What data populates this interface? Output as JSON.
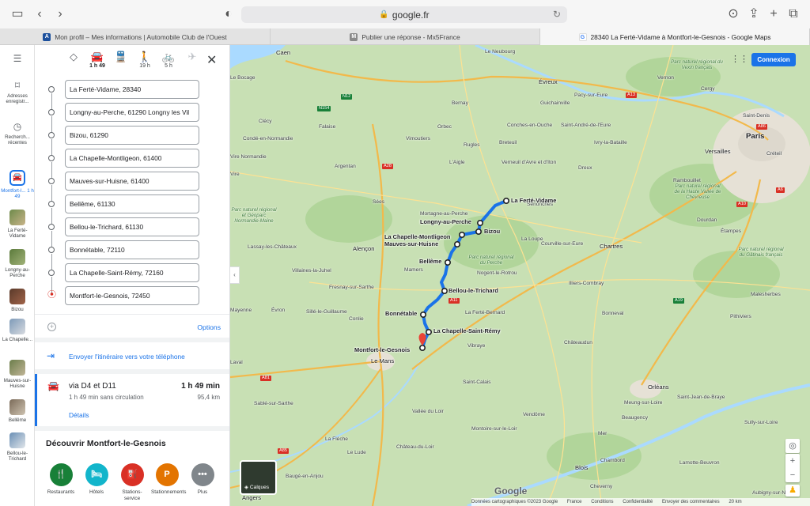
{
  "browser": {
    "url": "google.fr",
    "tabs": [
      {
        "title": "Mon profil – Mes informations | Automobile Club de l'Ouest",
        "favicon": "aco-icon"
      },
      {
        "title": "Publier une réponse - Mx5France",
        "favicon": "m-icon"
      },
      {
        "title": "28340 La Ferté-Vidame à Montfort-le-Gesnois - Google Maps",
        "favicon": "google-icon"
      }
    ]
  },
  "rail": {
    "items": [
      {
        "label": "Adresses enregistr...",
        "icon": "bookmark-icon"
      },
      {
        "label": "Recherch... récentes",
        "icon": "history-icon"
      },
      {
        "label": "Montfort-l... 1 h 49",
        "icon": "car-icon"
      },
      {
        "label": "La Ferté-Vidame"
      },
      {
        "label": "Longny-au-Perche"
      },
      {
        "label": "Bizou"
      },
      {
        "label": "La Chapelle..."
      },
      {
        "label": "Mauves-sur-Huisne"
      },
      {
        "label": "Bellême"
      },
      {
        "label": "Bellou-le-Trichard"
      }
    ]
  },
  "directions": {
    "modes": [
      {
        "name": "best-mode-icon",
        "label": ""
      },
      {
        "name": "car-icon",
        "label": "1 h 49"
      },
      {
        "name": "transit-icon",
        "label": ""
      },
      {
        "name": "walk-icon",
        "label": "19 h"
      },
      {
        "name": "bike-icon",
        "label": "5 h"
      },
      {
        "name": "flight-icon",
        "label": ""
      }
    ],
    "stops": [
      "La Ferté-Vidame, 28340",
      "Longny-au-Perche, 61290 Longny les Vil",
      "Bizou, 61290",
      "La Chapelle-Montligeon, 61400",
      "Mauves-sur-Huisne, 61400",
      "Bellême, 61130",
      "Bellou-le-Trichard, 61130",
      "Bonnétable, 72110",
      "La Chapelle-Saint-Rémy, 72160",
      "Montfort-le-Gesnois, 72450"
    ],
    "options_label": "Options",
    "send_label": "Envoyer l'itinéraire vers votre téléphone",
    "route": {
      "via": "via D4 et D11",
      "time": "1 h 49 min",
      "sub": "1 h 49 min sans circulation",
      "distance": "95,4 km",
      "details_label": "Détails"
    },
    "discover": {
      "title": "Découvrir Montfort-le-Gesnois",
      "items": [
        {
          "label": "Restaurants",
          "icon": "restaurant-icon",
          "color": "#188038"
        },
        {
          "label": "Hôtels",
          "icon": "hotel-icon",
          "color": "#12b5cb"
        },
        {
          "label": "Stations-service",
          "icon": "fuel-icon",
          "color": "#d93025"
        },
        {
          "label": "Stationnements",
          "icon": "parking-icon",
          "color": "#e37400"
        },
        {
          "label": "Plus",
          "icon": "more-icon",
          "color": "#80868b"
        }
      ]
    }
  },
  "map": {
    "connexion_label": "Connexion",
    "layers_label": "Calques",
    "route_color": "#1a73e8",
    "stop_labels": [
      "La Ferté-Vidame",
      "Longny-au-Perche",
      "Bizou",
      "La Chapelle-Montligeon",
      "Mauves-sur-Huisne",
      "Bellême",
      "Bellou-le-Trichard",
      "Bonnétable",
      "La Chapelle-Saint-Rémy",
      "Montfort-le-Gesnois"
    ],
    "places": [
      "Caen",
      "Le Neubourg",
      "Vernon",
      "Le Bocage",
      "Évreux",
      "Pacy-sur-Eure",
      "Guichainville",
      "Condé-en-Normandie",
      "Clécy",
      "Falaise",
      "Conches-en-Ouche",
      "Saint-André-de-l'Eure",
      "Vire Normandie",
      "Argentan",
      "Rugles",
      "Breteuil",
      "Ivry-la-Bataille",
      "L'Aigle",
      "Verneuil d'Avre et d'Iton",
      "Dreux",
      "Senonches",
      "Sées",
      "Alençon",
      "La Loupe",
      "Courville-sur-Eure",
      "Chartres",
      "Mortagne-au-Perche",
      "Nogent-le-Rotrou",
      "Mamers",
      "Illiers-Combray",
      "Bonneval",
      "Châteaudun",
      "Le Mans",
      "Saint-Calais",
      "Vendôme",
      "Orléans",
      "Sablé-sur-Sarthe",
      "La Flèche",
      "Chambord",
      "Blois",
      "Angers",
      "Paris",
      "Versailles",
      "Saint-Denis",
      "Créteil",
      "Rambouillet",
      "Cergy",
      "Mayenne",
      "Laval",
      "Vibraye",
      "Fresnay-sur-Sarthe",
      "Conlie",
      "Lassay-les-Châteaux",
      "Villaines-la-Juhel",
      "Évron",
      "Sillé-le-Guillaume",
      "La Ferté-Bernard",
      "Château-du-Loir",
      "Montoire-sur-le-Loir",
      "Meung-sur-Loire",
      "Beaugency",
      "Mer",
      "Saint-Jean-de-Braye",
      "Pithiviers",
      "Étampes",
      "Dourdan",
      "Malesherbes",
      "Sully-sur-Loire",
      "Lamotte-Beuvron",
      "Aubigny-sur-Nère",
      "Cheverny",
      "Baugé-en-Anjou",
      "Le Lude",
      "Vimoutiers",
      "Orbec",
      "Bernay",
      "Vallée du Loir",
      "Vire"
    ],
    "parks": [
      "Parc naturel régional du Vexin français",
      "Parc naturel régional de la Haute Vallée de Chevreuse",
      "Parc naturel régional du Gâtinais français",
      "Parc naturel régional et Géoparc Normandie-Maine",
      "Parc naturel régional du Perche"
    ],
    "roads": [
      "A13",
      "A28",
      "A11",
      "A10",
      "A81",
      "A85",
      "A19",
      "N12",
      "N154",
      "A86",
      "A6"
    ],
    "footer": {
      "logo": "Google",
      "items": [
        "Données cartographiques ©2023 Google",
        "France",
        "Conditions",
        "Confidentialité",
        "Envoyer des commentaires",
        "20 km"
      ]
    }
  }
}
